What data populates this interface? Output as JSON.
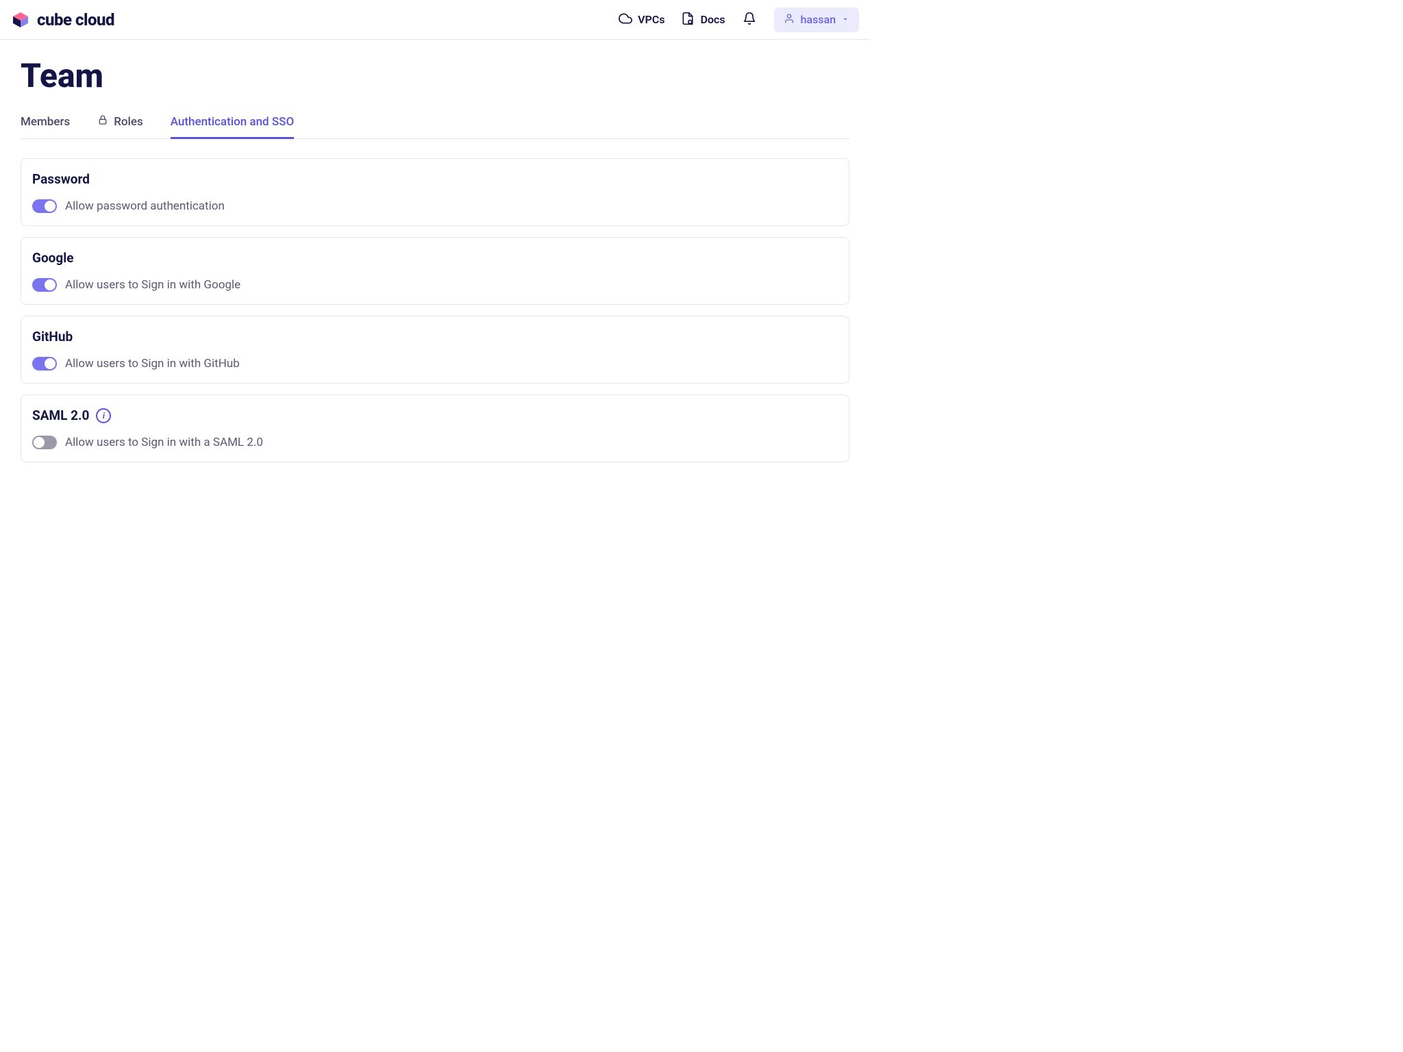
{
  "header": {
    "brand": "cube cloud",
    "links": {
      "vpcs": "VPCs",
      "docs": "Docs"
    },
    "user": "hassan"
  },
  "page": {
    "title": "Team"
  },
  "tabs": {
    "members": "Members",
    "roles": "Roles",
    "auth": "Authentication and SSO"
  },
  "cards": {
    "password": {
      "title": "Password",
      "toggle_label": "Allow password authentication",
      "enabled": true
    },
    "google": {
      "title": "Google",
      "toggle_label": "Allow users to Sign in with Google",
      "enabled": true
    },
    "github": {
      "title": "GitHub",
      "toggle_label": "Allow users to Sign in with GitHub",
      "enabled": true
    },
    "saml": {
      "title": "SAML 2.0",
      "toggle_label": "Allow users to Sign in with a SAML 2.0",
      "enabled": false
    }
  }
}
